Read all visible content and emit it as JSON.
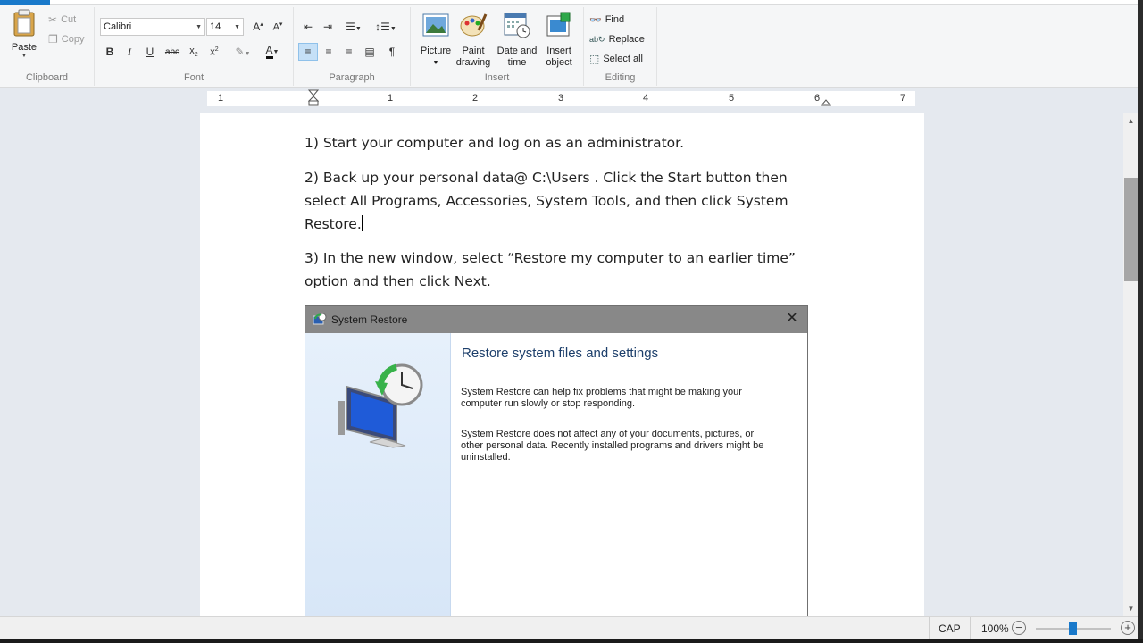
{
  "ribbon": {
    "clipboard": {
      "paste": "Paste",
      "cut": "Cut",
      "copy": "Copy",
      "label": "Clipboard"
    },
    "font": {
      "family": "Calibri",
      "size": "14",
      "label": "Font"
    },
    "paragraph": {
      "label": "Paragraph"
    },
    "insert": {
      "picture": "Picture",
      "paint_drawing": "Paint drawing",
      "date_time": "Date and time",
      "insert_object": "Insert object",
      "label": "Insert"
    },
    "editing": {
      "find": "Find",
      "replace": "Replace",
      "select_all": "Select all",
      "label": "Editing"
    }
  },
  "ruler": {
    "numbers": [
      "1",
      "1",
      "2",
      "3",
      "4",
      "5",
      "6",
      "7"
    ]
  },
  "document": {
    "p1": "1) Start your computer and log on as an administrator.",
    "p2": "2) Back up your personal data@ C:\\Users . Click the Start button then select All Programs, Accessories, System Tools, and then click System Restore.",
    "p3": "3) In the new window, select “Restore my computer to an earlier time” option and then click Next."
  },
  "dialog": {
    "title": "System Restore",
    "heading": "Restore system files and settings",
    "text1": "System Restore can help fix problems that might be making your computer run slowly or stop responding.",
    "text2": "System Restore does not affect any of your documents, pictures, or other personal data. Recently installed programs and drivers might be uninstalled."
  },
  "status": {
    "caps": "CAP",
    "zoom": "100%",
    "zoom_level_percent": 100
  },
  "colors": {
    "accent": "#1979ca",
    "page": "#ffffff",
    "workspace": "#e5e9ef"
  }
}
